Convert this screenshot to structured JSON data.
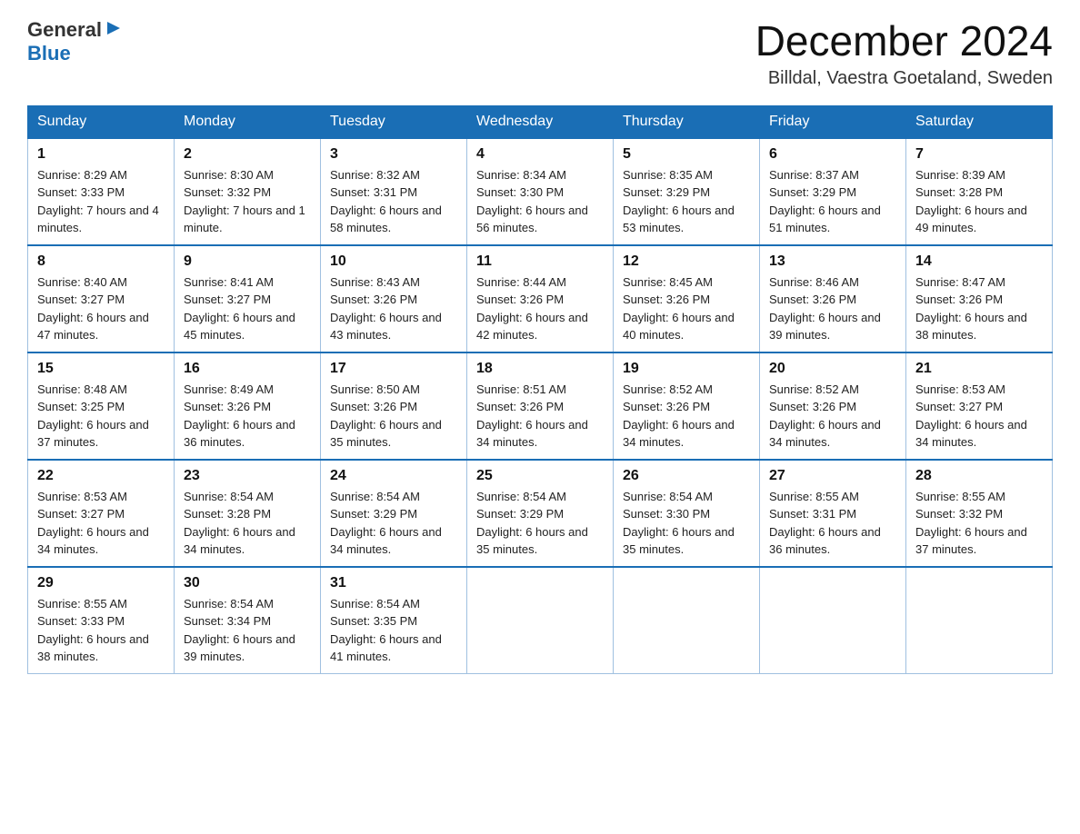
{
  "header": {
    "logo_general": "General",
    "logo_blue": "Blue",
    "month_title": "December 2024",
    "location": "Billdal, Vaestra Goetaland, Sweden"
  },
  "weekdays": [
    "Sunday",
    "Monday",
    "Tuesday",
    "Wednesday",
    "Thursday",
    "Friday",
    "Saturday"
  ],
  "weeks": [
    [
      {
        "day": "1",
        "sunrise": "8:29 AM",
        "sunset": "3:33 PM",
        "daylight": "7 hours and 4 minutes."
      },
      {
        "day": "2",
        "sunrise": "8:30 AM",
        "sunset": "3:32 PM",
        "daylight": "7 hours and 1 minute."
      },
      {
        "day": "3",
        "sunrise": "8:32 AM",
        "sunset": "3:31 PM",
        "daylight": "6 hours and 58 minutes."
      },
      {
        "day": "4",
        "sunrise": "8:34 AM",
        "sunset": "3:30 PM",
        "daylight": "6 hours and 56 minutes."
      },
      {
        "day": "5",
        "sunrise": "8:35 AM",
        "sunset": "3:29 PM",
        "daylight": "6 hours and 53 minutes."
      },
      {
        "day": "6",
        "sunrise": "8:37 AM",
        "sunset": "3:29 PM",
        "daylight": "6 hours and 51 minutes."
      },
      {
        "day": "7",
        "sunrise": "8:39 AM",
        "sunset": "3:28 PM",
        "daylight": "6 hours and 49 minutes."
      }
    ],
    [
      {
        "day": "8",
        "sunrise": "8:40 AM",
        "sunset": "3:27 PM",
        "daylight": "6 hours and 47 minutes."
      },
      {
        "day": "9",
        "sunrise": "8:41 AM",
        "sunset": "3:27 PM",
        "daylight": "6 hours and 45 minutes."
      },
      {
        "day": "10",
        "sunrise": "8:43 AM",
        "sunset": "3:26 PM",
        "daylight": "6 hours and 43 minutes."
      },
      {
        "day": "11",
        "sunrise": "8:44 AM",
        "sunset": "3:26 PM",
        "daylight": "6 hours and 42 minutes."
      },
      {
        "day": "12",
        "sunrise": "8:45 AM",
        "sunset": "3:26 PM",
        "daylight": "6 hours and 40 minutes."
      },
      {
        "day": "13",
        "sunrise": "8:46 AM",
        "sunset": "3:26 PM",
        "daylight": "6 hours and 39 minutes."
      },
      {
        "day": "14",
        "sunrise": "8:47 AM",
        "sunset": "3:26 PM",
        "daylight": "6 hours and 38 minutes."
      }
    ],
    [
      {
        "day": "15",
        "sunrise": "8:48 AM",
        "sunset": "3:25 PM",
        "daylight": "6 hours and 37 minutes."
      },
      {
        "day": "16",
        "sunrise": "8:49 AM",
        "sunset": "3:26 PM",
        "daylight": "6 hours and 36 minutes."
      },
      {
        "day": "17",
        "sunrise": "8:50 AM",
        "sunset": "3:26 PM",
        "daylight": "6 hours and 35 minutes."
      },
      {
        "day": "18",
        "sunrise": "8:51 AM",
        "sunset": "3:26 PM",
        "daylight": "6 hours and 34 minutes."
      },
      {
        "day": "19",
        "sunrise": "8:52 AM",
        "sunset": "3:26 PM",
        "daylight": "6 hours and 34 minutes."
      },
      {
        "day": "20",
        "sunrise": "8:52 AM",
        "sunset": "3:26 PM",
        "daylight": "6 hours and 34 minutes."
      },
      {
        "day": "21",
        "sunrise": "8:53 AM",
        "sunset": "3:27 PM",
        "daylight": "6 hours and 34 minutes."
      }
    ],
    [
      {
        "day": "22",
        "sunrise": "8:53 AM",
        "sunset": "3:27 PM",
        "daylight": "6 hours and 34 minutes."
      },
      {
        "day": "23",
        "sunrise": "8:54 AM",
        "sunset": "3:28 PM",
        "daylight": "6 hours and 34 minutes."
      },
      {
        "day": "24",
        "sunrise": "8:54 AM",
        "sunset": "3:29 PM",
        "daylight": "6 hours and 34 minutes."
      },
      {
        "day": "25",
        "sunrise": "8:54 AM",
        "sunset": "3:29 PM",
        "daylight": "6 hours and 35 minutes."
      },
      {
        "day": "26",
        "sunrise": "8:54 AM",
        "sunset": "3:30 PM",
        "daylight": "6 hours and 35 minutes."
      },
      {
        "day": "27",
        "sunrise": "8:55 AM",
        "sunset": "3:31 PM",
        "daylight": "6 hours and 36 minutes."
      },
      {
        "day": "28",
        "sunrise": "8:55 AM",
        "sunset": "3:32 PM",
        "daylight": "6 hours and 37 minutes."
      }
    ],
    [
      {
        "day": "29",
        "sunrise": "8:55 AM",
        "sunset": "3:33 PM",
        "daylight": "6 hours and 38 minutes."
      },
      {
        "day": "30",
        "sunrise": "8:54 AM",
        "sunset": "3:34 PM",
        "daylight": "6 hours and 39 minutes."
      },
      {
        "day": "31",
        "sunrise": "8:54 AM",
        "sunset": "3:35 PM",
        "daylight": "6 hours and 41 minutes."
      },
      null,
      null,
      null,
      null
    ]
  ]
}
